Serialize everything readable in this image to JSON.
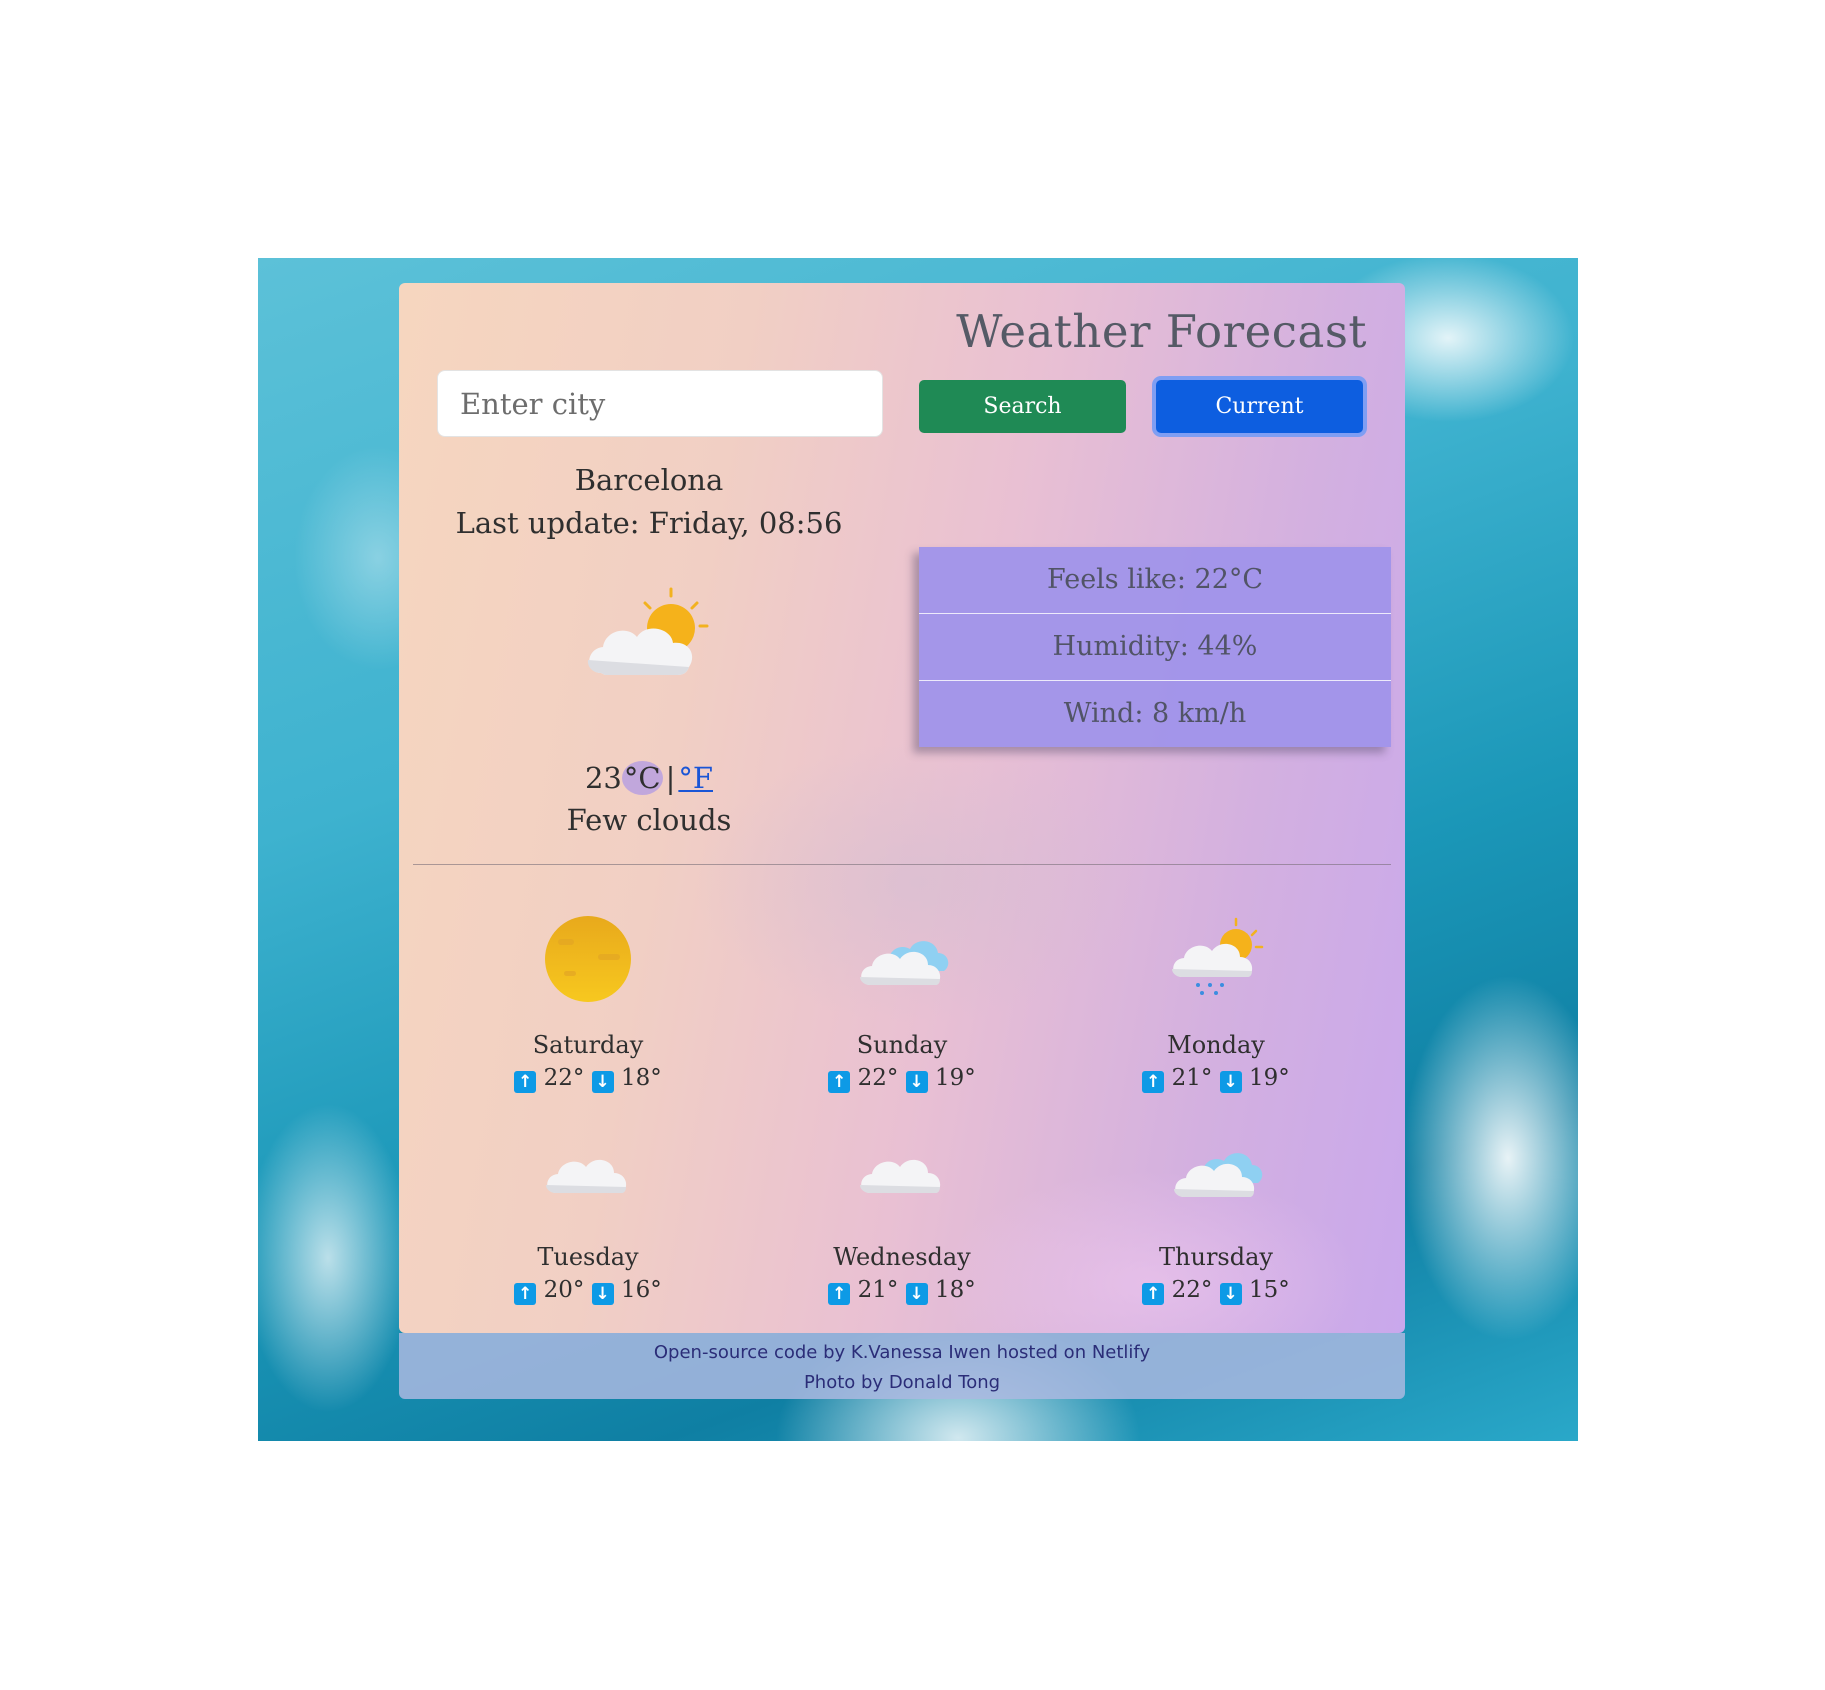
{
  "app": {
    "title": "Weather Forecast"
  },
  "search": {
    "placeholder": "Enter city",
    "value": "",
    "search_label": "Search",
    "current_label": "Current"
  },
  "current": {
    "city": "Barcelona",
    "last_update": "Last update: Friday, 08:56",
    "icon": "few-clouds-day-icon",
    "temperature": "23",
    "unit_c": "°C",
    "unit_separator": "|",
    "unit_f": "°F",
    "description": "Few clouds"
  },
  "details": {
    "feels_like": "Feels like: 22°C",
    "humidity": "Humidity: 44%",
    "wind": "Wind: 8 km/h"
  },
  "forecast": [
    {
      "day": "Saturday",
      "high": "22°",
      "low": "18°",
      "icon": "clear-sky-icon"
    },
    {
      "day": "Sunday",
      "high": "22°",
      "low": "19°",
      "icon": "broken-clouds-icon"
    },
    {
      "day": "Monday",
      "high": "21°",
      "low": "19°",
      "icon": "rain-day-icon"
    },
    {
      "day": "Tuesday",
      "high": "20°",
      "low": "16°",
      "icon": "scattered-clouds-icon"
    },
    {
      "day": "Wednesday",
      "high": "21°",
      "low": "18°",
      "icon": "scattered-clouds-icon"
    },
    {
      "day": "Thursday",
      "high": "22°",
      "low": "15°",
      "icon": "broken-clouds-icon"
    }
  ],
  "footer": {
    "prefix1": "Open-source code",
    "by": " by ",
    "author": "K.Vanessa Iwen",
    "hosted": " hosted on ",
    "host": "Netlify",
    "photo_prefix": "Photo by ",
    "photographer": "Donald Tong"
  },
  "colors": {
    "search_button": "#1f8a55",
    "current_button": "#0d5ee0",
    "details_panel": "#a094ea",
    "arrow_badge": "#0d9ae6",
    "link": "#1a55d6"
  }
}
